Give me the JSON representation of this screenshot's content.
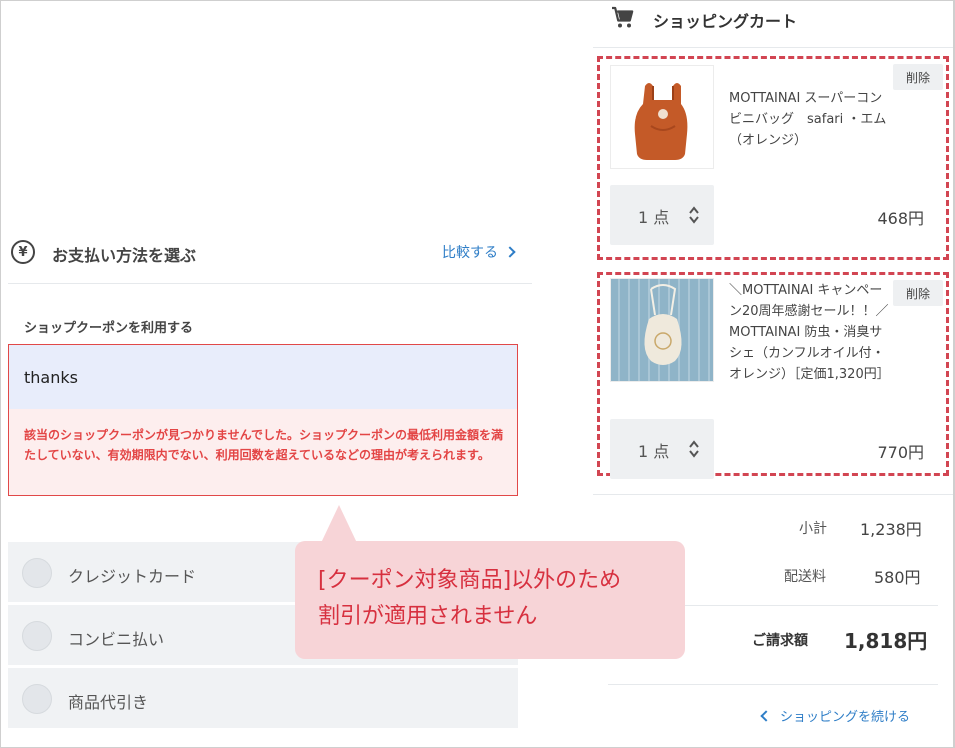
{
  "cart": {
    "title": "ショッピングカート",
    "items": [
      {
        "name": "MOTTAINAI スーパーコンビニバッグ　safari ・エム （オレンジ）",
        "delete_label": "削除",
        "quantity": "1 点",
        "price": "468円"
      },
      {
        "name": "＼MOTTAINAI キャンペーン20周年感謝セール！！／MOTTAINAI 防虫・消臭サシェ（カンフルオイル付・オレンジ）［定価1,320円］",
        "delete_label": "削除",
        "quantity": "1 点",
        "price": "770円"
      }
    ],
    "subtotal_label": "小計",
    "subtotal": "1,238円",
    "shipping_label": "配送料",
    "shipping": "580円",
    "total_label": "ご請求額",
    "total": "1,818円",
    "continue_label": "ショッピングを続ける"
  },
  "payment": {
    "title": "お支払い方法を選ぶ",
    "compare_label": "比較する",
    "coupon_label": "ショップクーポンを利用する",
    "coupon_value": "thanks",
    "coupon_error": "該当のショップクーポンが見つかりませんでした。ショップクーポンの最低利用金額を満たしていない、有効期限内でない、利用回数を超えているなどの理由が考えられます。",
    "methods": [
      "クレジットカード",
      "コンビニ払い",
      "商品代引き"
    ]
  },
  "callout": {
    "line1": "[クーポン対象商品]以外のため",
    "line2": "割引が適用されません"
  },
  "colors": {
    "accent_link": "#2f7ec7",
    "error_red": "#e34545",
    "dashed_highlight": "#d24552",
    "callout_bg": "#f7d4d7",
    "callout_text": "#d7303f"
  }
}
